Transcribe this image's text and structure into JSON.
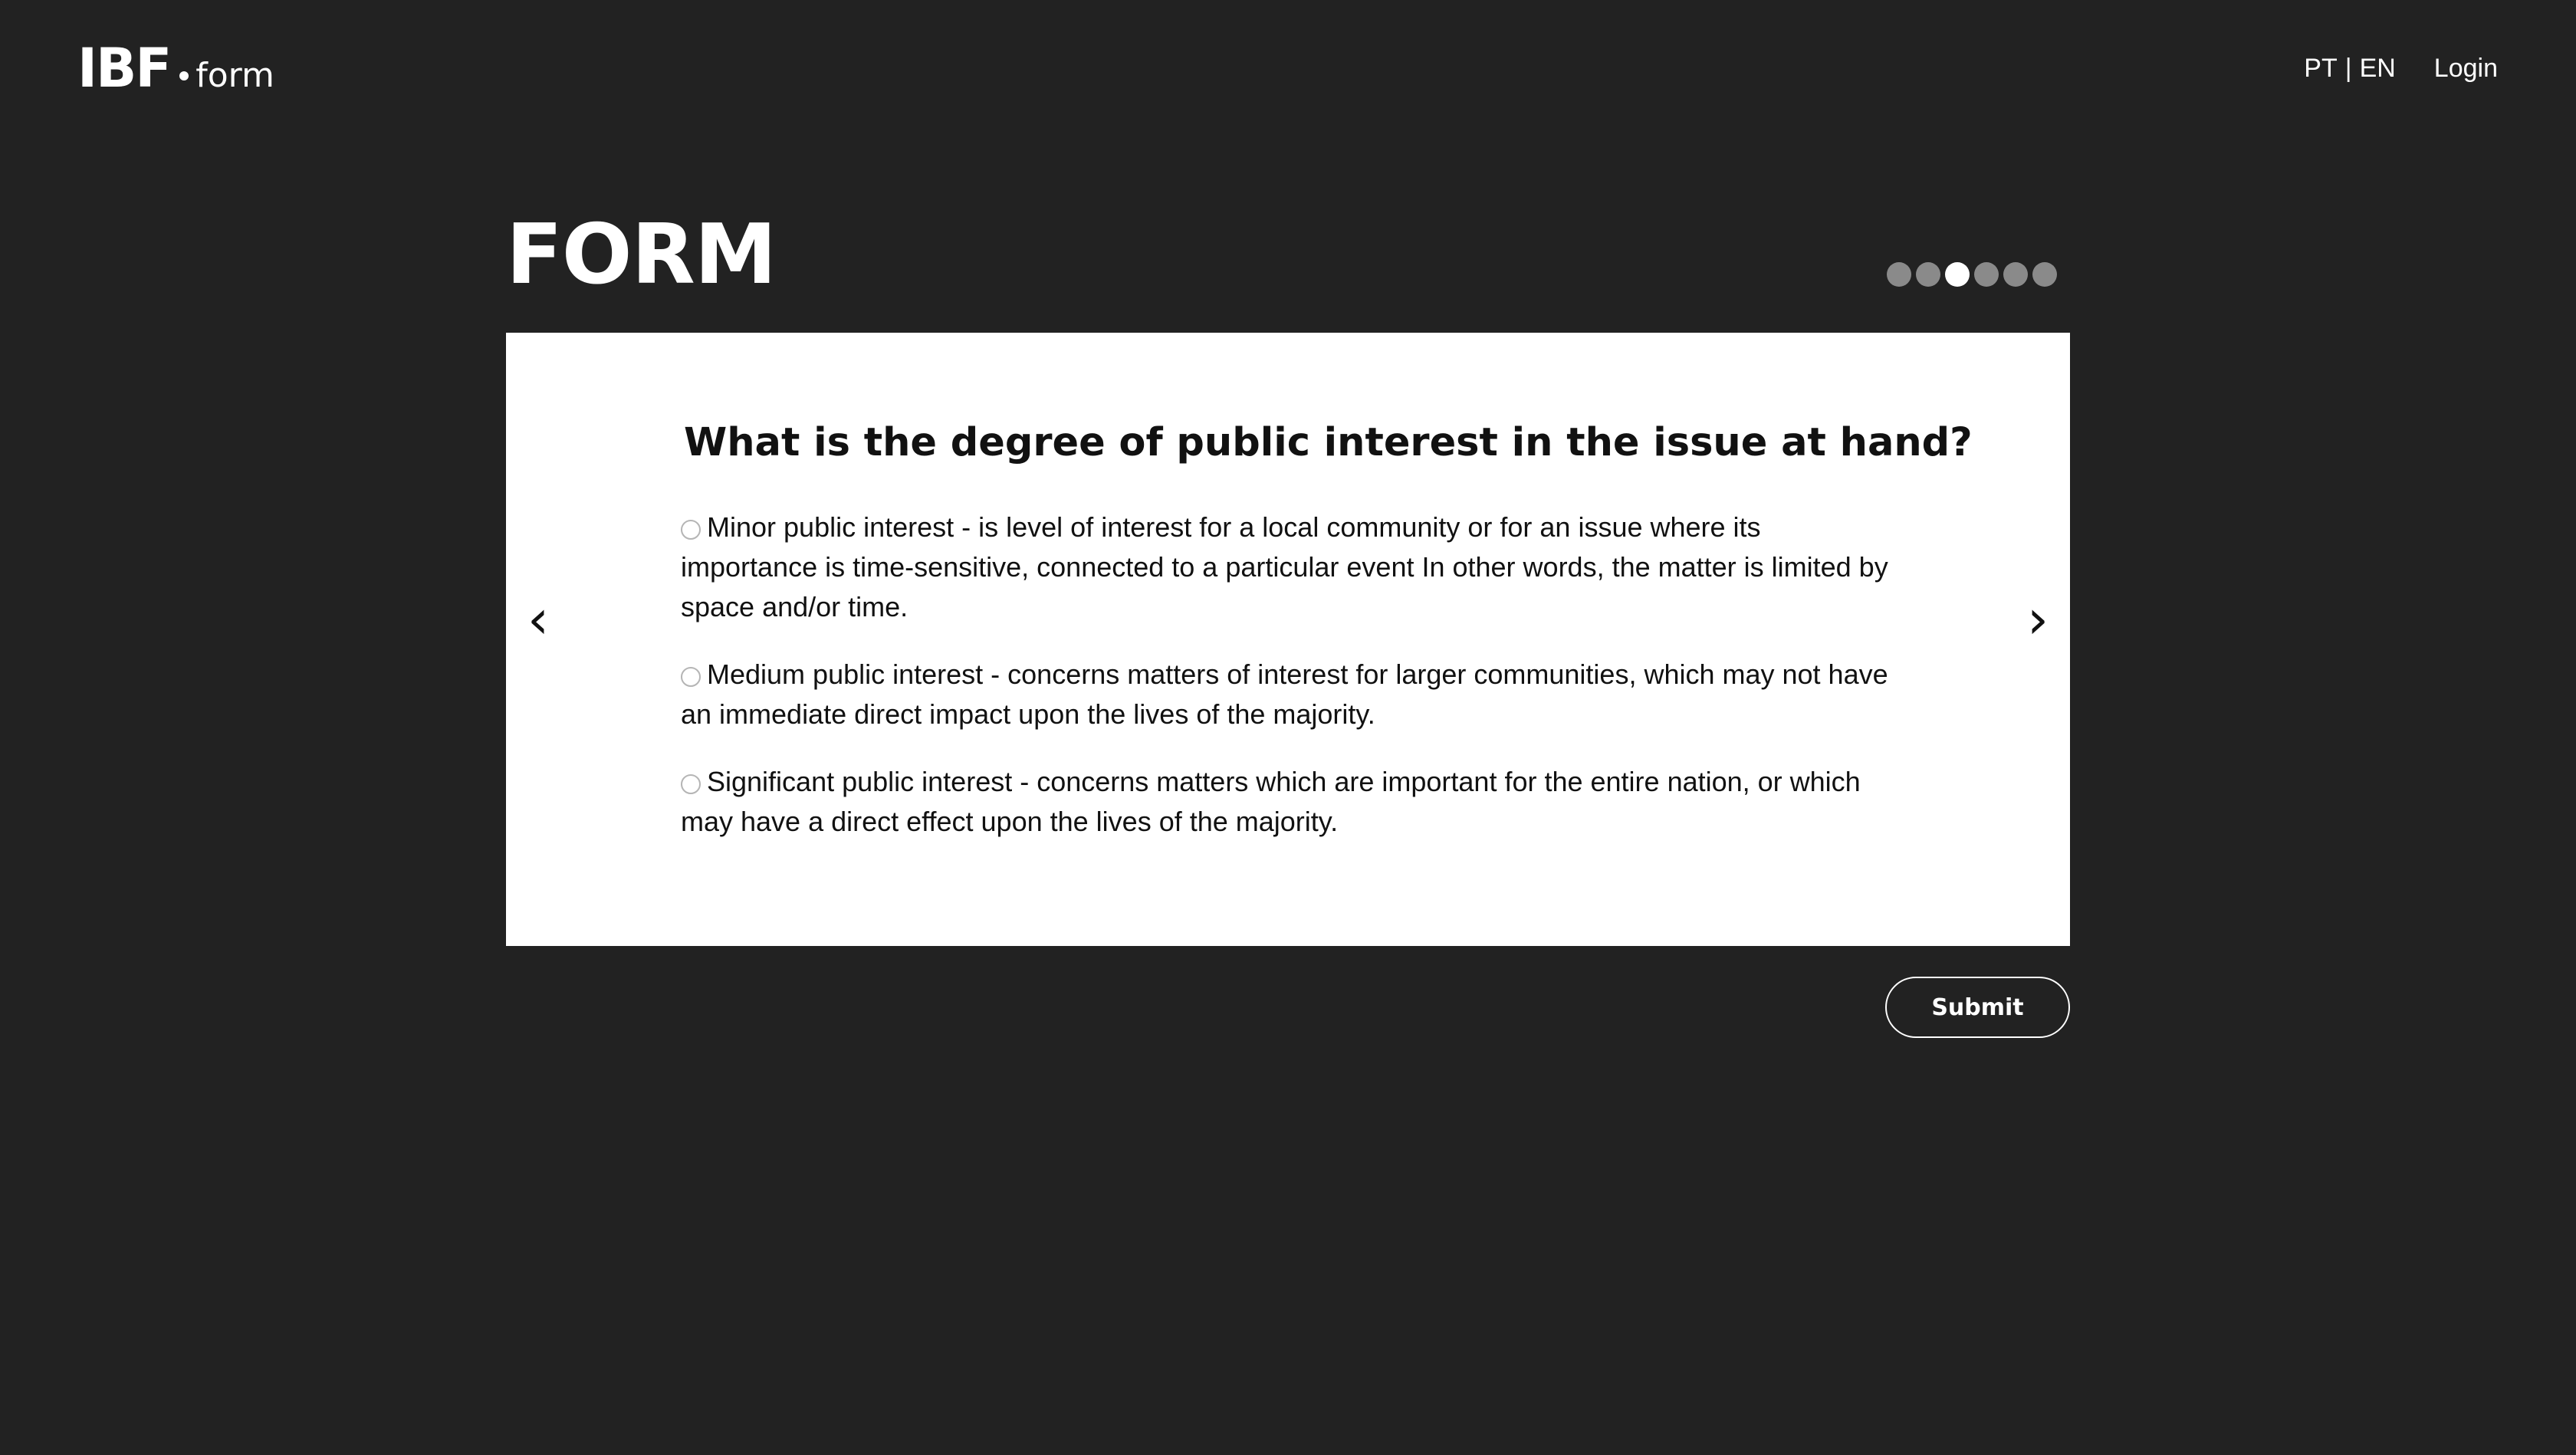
{
  "header": {
    "logo_main": "IBF",
    "logo_sub": "form",
    "lang_pt": "PT",
    "lang_separator": "|",
    "lang_en": "EN",
    "login_label": "Login"
  },
  "form": {
    "title": "FORM",
    "steps": {
      "total": 6,
      "current": 3
    },
    "prev_arrow": "‹",
    "next_arrow": "›",
    "question": "What is the degree of public interest in the issue at hand?",
    "options": [
      {
        "label": "Minor public interest - is level of interest for a local community or for an issue where its importance is time-sensitive, connected to a particular event In other words, the matter is limited by space and/or time.",
        "selected": false
      },
      {
        "label": "Medium public interest - concerns matters of interest for larger communities, which may not have an immediate direct impact upon the lives of the majority.",
        "selected": false
      },
      {
        "label": "Significant public interest - concerns matters which are important for the entire nation, or which may have a direct effect upon the lives of the majority.",
        "selected": false
      }
    ],
    "submit_label": "Submit"
  },
  "colors": {
    "background": "#222222",
    "card": "#ffffff",
    "dot_active": "#ffffff",
    "dot_inactive": "#8a8a8a"
  }
}
